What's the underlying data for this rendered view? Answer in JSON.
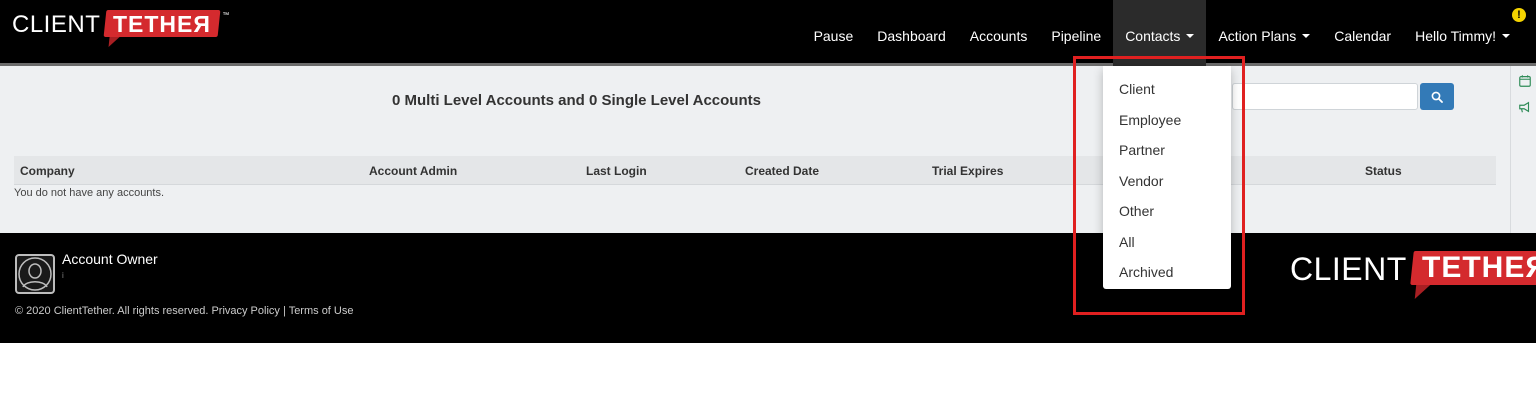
{
  "brand": {
    "client": "CLIENT",
    "tether": "TETHEЯ",
    "tm": "™",
    "red": "#d42a2e"
  },
  "nav": {
    "items": [
      {
        "label": "Pause"
      },
      {
        "label": "Dashboard"
      },
      {
        "label": "Accounts"
      },
      {
        "label": "Pipeline"
      },
      {
        "label": "Contacts"
      },
      {
        "label": "Action Plans"
      },
      {
        "label": "Calendar"
      },
      {
        "label": "Hello Timmy!"
      }
    ],
    "alert": "!"
  },
  "main": {
    "summary": "0 Multi Level Accounts and 0 Single Level Accounts",
    "search": {
      "value": "",
      "button_icon": "search-icon"
    },
    "table": {
      "columns": [
        "Company",
        "Account Admin",
        "Last Login",
        "Created Date",
        "Trial Expires",
        "Status"
      ],
      "empty_message": "You do not have any accounts."
    }
  },
  "contacts_menu": {
    "items": [
      "Client",
      "Employee",
      "Partner",
      "Vendor",
      "Other",
      "All",
      "Archived"
    ]
  },
  "footer": {
    "owner_label": "Account Owner",
    "owner_sub": "i",
    "copyright": "© 2020 ClientTether. All rights reserved.",
    "privacy": "Privacy Policy",
    "separator": "|",
    "terms": "Terms of Use"
  },
  "colors": {
    "navbar": "#000000",
    "primary_button": "#337ab7",
    "highlight": "#e02020",
    "alert": "#f5d400"
  }
}
